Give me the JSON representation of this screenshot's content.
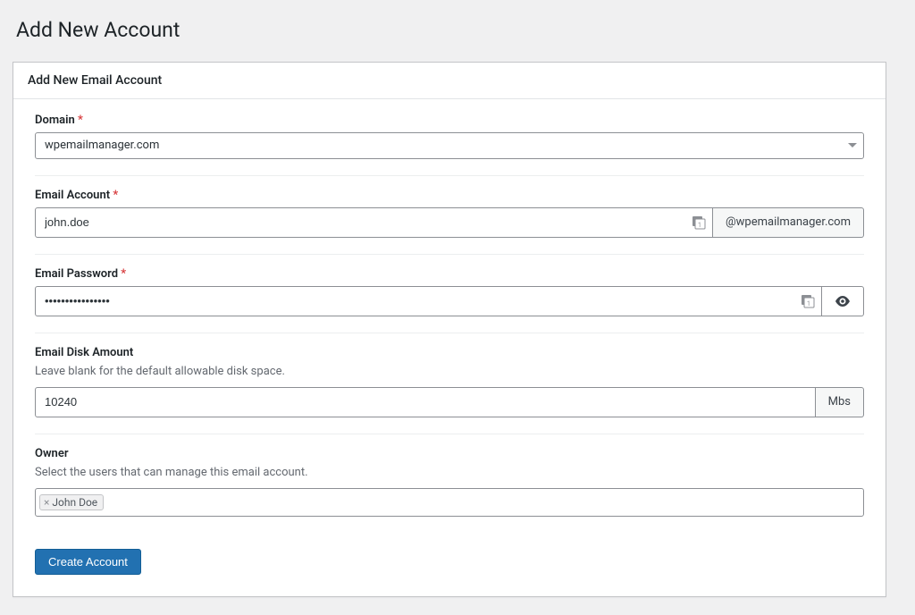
{
  "page": {
    "title": "Add New Account"
  },
  "panel": {
    "header": "Add New Email Account"
  },
  "fields": {
    "domain": {
      "label": "Domain",
      "required": "*",
      "value": "wpemailmanager.com"
    },
    "email_account": {
      "label": "Email Account",
      "required": "*",
      "value": "john.doe",
      "suffix": "@wpemailmanager.com"
    },
    "email_password": {
      "label": "Email Password",
      "required": "*",
      "value": "••••••••••••••••"
    },
    "disk_amount": {
      "label": "Email Disk Amount",
      "help": "Leave blank for the default allowable disk space.",
      "value": "10240",
      "unit": "Mbs"
    },
    "owner": {
      "label": "Owner",
      "help": "Select the users that can manage this email account.",
      "tags": [
        "John Doe"
      ]
    }
  },
  "buttons": {
    "submit": "Create Account"
  }
}
